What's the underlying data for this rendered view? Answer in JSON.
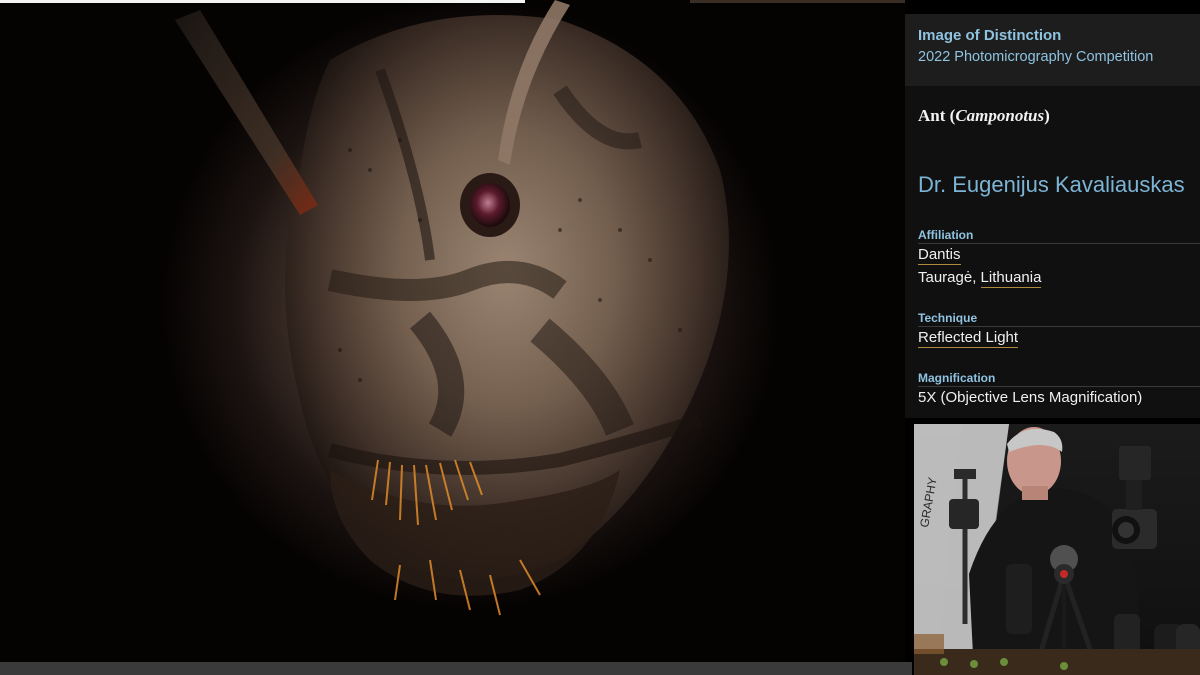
{
  "panel": {
    "award": "Image of Distinction",
    "competition": "2022 Photomicrography Competition",
    "specimen_common": "Ant (",
    "specimen_latin": "Camponotus",
    "specimen_close": ")",
    "author": "Dr. Eugenijus Kavaliauskas",
    "affiliation_label": "Affiliation",
    "affiliation_org": "Dantis",
    "affiliation_city": "Tauragė, ",
    "affiliation_country": "Lithuania",
    "technique_label": "Technique",
    "technique_value": "Reflected Light",
    "magnification_label": "Magnification",
    "magnification_value": "5X (Objective Lens Magnification)"
  },
  "webcam": {
    "backdrop_text": "GRAPHY"
  },
  "colors": {
    "label_blue": "#8fc3e0",
    "author_blue": "#7cb4d6",
    "panel_bg": "#101010",
    "link_underline": "#b08a3c"
  }
}
